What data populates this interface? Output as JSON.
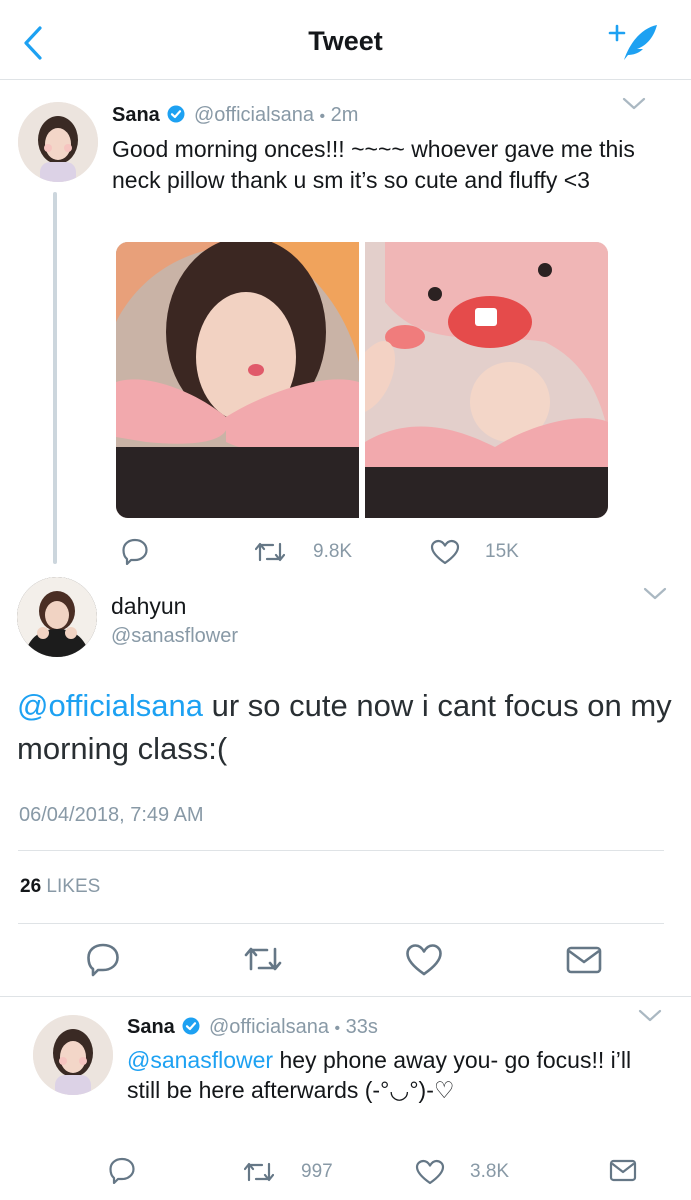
{
  "header": {
    "title": "Tweet"
  },
  "tweet1": {
    "name": "Sana",
    "handle": "@officialsana",
    "sep": "•",
    "time": "2m",
    "text": "Good morning onces!!! ~~~~ whoever gave me this neck pillow thank u sm it’s so cute and fluffy <3",
    "retweets": "9.8K",
    "likes": "15K"
  },
  "main": {
    "name": "dahyun",
    "handle": "@sanasflower",
    "mention": "@officialsana",
    "text": " ur so cute now i cant focus on my morning class:(",
    "timestamp": "06/04/2018, 7:49 AM",
    "likes_count": "26",
    "likes_label": "LIKES"
  },
  "reply": {
    "name": "Sana",
    "handle": "@officialsana",
    "sep": "•",
    "time": "33s",
    "mention": "@sanasflower",
    "text": " hey phone away you- go focus!! i’ll still be here afterwards  (-°◡°)-♡",
    "retweets": "997",
    "likes": "3.8K"
  },
  "colors": {
    "accent": "#1da1f2",
    "text": "#14171a",
    "muted": "#8899a6",
    "divider": "#dfe3e6"
  }
}
